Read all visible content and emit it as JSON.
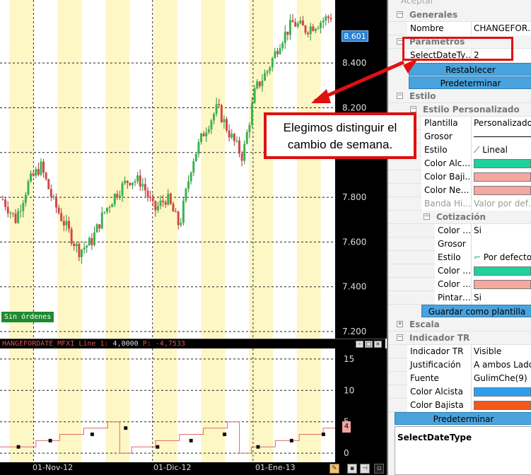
{
  "chart": {
    "indicator_header": {
      "name": "HANGEFORDATE_MFXI Line 1:",
      "value": "4,0000",
      "p_label": "P:",
      "p_value": "-4,7533"
    },
    "badge": "Sin órdenes",
    "current_price": "8.601",
    "indicator_current_value": "4",
    "x_labels": [
      "01-Nov-12",
      "01-Dic-12",
      "01-Ene-13"
    ]
  },
  "callout": {
    "line1": "Elegimos distinguir el",
    "line2": "cambio de semana."
  },
  "chart_data": [
    {
      "type": "line",
      "title": "",
      "y_axis_labels": [
        "8.601",
        "8.400",
        "8.200",
        "8.000",
        "7.800",
        "7.600",
        "7.400",
        "7.200"
      ],
      "ylim": [
        7.2,
        8.65
      ],
      "x": [
        "01-Nov-12",
        "01-Dic-12",
        "01-Ene-13"
      ],
      "series": [
        {
          "values": [
            7.79,
            7.7,
            7.86,
            7.94,
            7.78,
            7.67,
            7.56,
            7.6,
            7.73,
            7.82,
            7.88,
            7.87,
            7.74,
            7.8,
            7.67,
            7.96,
            8.1,
            8.2,
            8.08,
            7.98,
            8.28,
            8.37,
            8.5,
            8.58,
            8.55,
            8.58,
            8.61
          ]
        }
      ],
      "grid": true,
      "week_shading": true
    },
    {
      "type": "line",
      "y_axis_labels": [
        "15",
        "10",
        "5",
        "4",
        "0"
      ],
      "ylim": [
        -1,
        16
      ],
      "series": [
        {
          "values": [
            1,
            1,
            1,
            2,
            2,
            3,
            3,
            4,
            4,
            5,
            0,
            1,
            1,
            2,
            2,
            3,
            3,
            4,
            4,
            5,
            0,
            1,
            1,
            2,
            2,
            3,
            3,
            4
          ]
        }
      ],
      "markers": [
        {
          "x": 0.055,
          "value": 1
        },
        {
          "x": 0.15,
          "value": 2
        },
        {
          "x": 0.275,
          "value": 3
        },
        {
          "x": 0.375,
          "value": 4
        },
        {
          "x": 0.47,
          "value": 1
        },
        {
          "x": 0.57,
          "value": 2
        },
        {
          "x": 0.67,
          "value": 3
        },
        {
          "x": 0.77,
          "value": 1
        },
        {
          "x": 0.87,
          "value": 2
        },
        {
          "x": 0.965,
          "value": 3
        }
      ]
    }
  ],
  "props": {
    "top_label": "Aceptar",
    "generales": {
      "label": "Generales",
      "nombre_label": "Nombre",
      "nombre_value": "CHANGEFOR…"
    },
    "parametros": {
      "label": "Parámetros",
      "selectdate_label": "SelectDateTy…",
      "selectdate_value": "2"
    },
    "btn_restablecer": "Restablecer",
    "btn_predeterminar": "Predeterminar",
    "estilo": {
      "label": "Estilo",
      "personalizado_label": "Estilo Personalizado"
    },
    "plantilla": {
      "label": "Plantilla",
      "value": "Personalizado"
    },
    "grosor_label": "Grosor",
    "estilo_row": {
      "label": "Estilo",
      "value": "Lineal"
    },
    "color_alc": {
      "label": "Color Alc…",
      "color": "#1fd19a"
    },
    "color_baj": {
      "label": "Color Baji…",
      "color": "#f5a8a0"
    },
    "color_ne": {
      "label": "Color Ne…",
      "color": "#f5a8a0"
    },
    "banda": {
      "label": "Banda Hi…",
      "value": "Valor por def…"
    },
    "cotizacion": {
      "label": "Cotización"
    },
    "cot_color1": {
      "label": "Color …",
      "value": "Si"
    },
    "cot_grosor": "Grosor",
    "cot_estilo": {
      "label": "Estilo",
      "value": "Por defecto"
    },
    "cot_color2": {
      "label": "Color …",
      "color": "#1fd19a"
    },
    "cot_color3": {
      "label": "Color …",
      "color": "#f5a8a0"
    },
    "cot_pintar": {
      "label": "Pintar…",
      "value": "Si"
    },
    "btn_guardar": "Guardar como plantilla",
    "escala": "Escala",
    "indicador": {
      "label": "Indicador TR"
    },
    "ind_tr": {
      "label": "Indicador TR",
      "value": "Visible"
    },
    "justif": {
      "label": "Justificación",
      "value": "A ambos Lados"
    },
    "fuente": {
      "label": "Fuente",
      "value": "GulimChe(9)"
    },
    "color_alcista": {
      "label": "Color Alcista",
      "color": "#2e9ff0"
    },
    "color_bajista": {
      "label": "Color Bajista",
      "color": "#f05a1e"
    },
    "btn_predeterminar2": "Predeterminar",
    "desc_title": "SelectDateType"
  }
}
